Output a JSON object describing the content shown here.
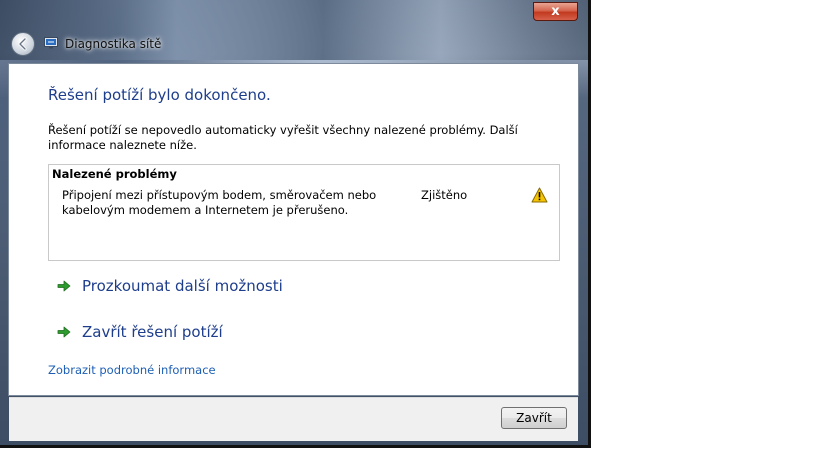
{
  "window": {
    "title": "Diagnostika sítě",
    "close_label": "x"
  },
  "main": {
    "heading": "Řešení potíží bylo dokončeno.",
    "description": "Řešení potíží se nepovedlo automaticky vyřešit všechny nalezené problémy. Další informace naleznete níže.",
    "problems": {
      "title": "Nalezené problémy",
      "items": [
        {
          "description": "Připojení mezi přístupovým bodem, směrovačem nebo kabelovým modemem a Internetem je přerušeno.",
          "status": "Zjištěno",
          "icon": "warning-icon"
        }
      ]
    },
    "commands": [
      {
        "label": "Prozkoumat další možnosti",
        "icon": "green-arrow-icon"
      },
      {
        "label": "Zavřít řešení potíží",
        "icon": "green-arrow-icon"
      }
    ],
    "details_link": "Zobrazit podrobné informace"
  },
  "footer": {
    "close_label": "Zavřít"
  },
  "colors": {
    "heading": "#1e3e8c",
    "link": "#1e5fb4",
    "accent_green": "#2e9b2e",
    "warning": "#f5c400"
  }
}
